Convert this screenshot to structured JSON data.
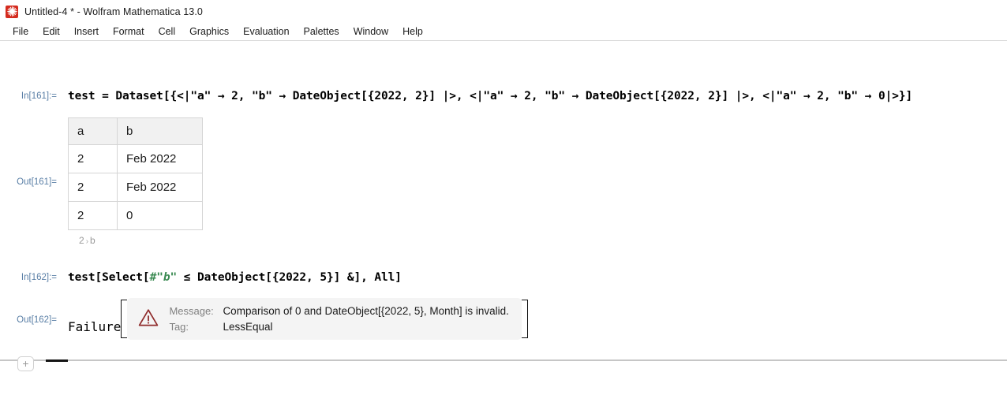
{
  "window": {
    "title": "Untitled-4 * - Wolfram Mathematica 13.0",
    "icon": "mathematica-spikey-icon"
  },
  "menubar": {
    "items": [
      {
        "label": "File"
      },
      {
        "label": "Edit"
      },
      {
        "label": "Insert"
      },
      {
        "label": "Format"
      },
      {
        "label": "Cell"
      },
      {
        "label": "Graphics"
      },
      {
        "label": "Evaluation"
      },
      {
        "label": "Palettes"
      },
      {
        "label": "Window"
      },
      {
        "label": "Help"
      }
    ]
  },
  "notebook": {
    "cells": {
      "in161": {
        "label": "In[161]:=",
        "code": "test = Dataset[{<|\"a\" → 2, \"b\" → DateObject[{2022, 2}] |>, <|\"a\" → 2, \"b\" → DateObject[{2022, 2}] |>, <|\"a\" → 2, \"b\" → 0|>}]"
      },
      "out161": {
        "label": "Out[161]=",
        "dataset": {
          "columns": [
            "a",
            "b"
          ],
          "rows": [
            [
              "2",
              "Feb 2022"
            ],
            [
              "2",
              "Feb 2022"
            ],
            [
              "2",
              "0"
            ]
          ],
          "breadcrumb": [
            "2",
            "b"
          ],
          "breadcrumb_separator": "›"
        }
      },
      "in162": {
        "label": "In[162]:=",
        "code_prefix": "test[Select[",
        "code_pattern": "#\"b\"",
        "code_suffix": " ≤ DateObject[{2022, 5}] &], All]"
      },
      "out162": {
        "label": "Out[162]=",
        "head": "Failure",
        "warning_icon": "warning-triangle-icon",
        "message_key": "Message:",
        "message_value": "Comparison of 0 and DateObject[{2022, 5}, Month] is invalid.",
        "tag_key": "Tag:",
        "tag_value": "LessEqual"
      }
    },
    "insert_button_label": "+"
  },
  "colors": {
    "cell_label": "#5a7fa6",
    "pattern_green": "#3a8a52",
    "warning_red": "#8f2b2b",
    "message_bg": "#f4f4f4",
    "table_header_bg": "#f1f1f1",
    "table_border": "#d5d5d5",
    "app_icon_red": "#d42b1e"
  }
}
